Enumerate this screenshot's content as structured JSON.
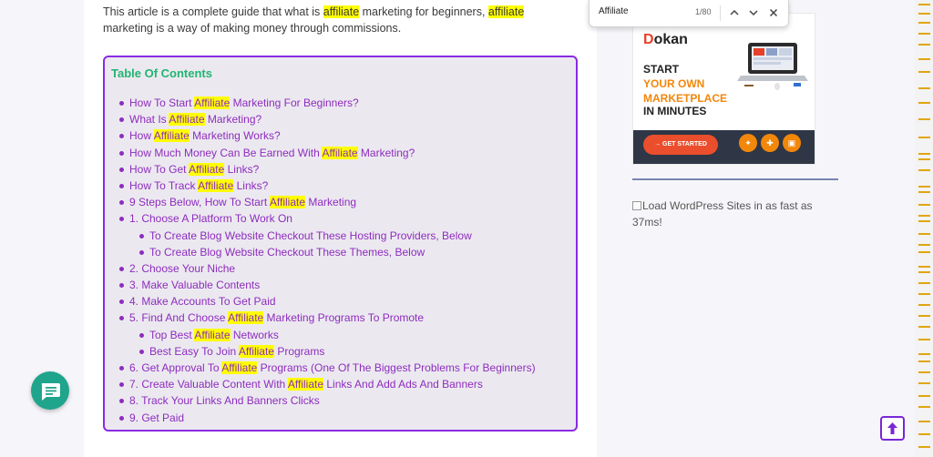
{
  "article": {
    "intro": [
      {
        "t": "This article is a complete guide that what is "
      },
      {
        "t": "affiliate",
        "hl": true
      },
      {
        "t": " marketing for beginners, "
      },
      {
        "t": "affiliate",
        "hl": true
      },
      {
        "t": " marketing is a way of making money through commissions."
      }
    ]
  },
  "toc": {
    "title": "Table Of Contents",
    "items": [
      {
        "level": 1,
        "parts": [
          {
            "t": "How To Start "
          },
          {
            "t": "Affiliate",
            "hl": true
          },
          {
            "t": " Marketing For Beginners?"
          }
        ]
      },
      {
        "level": 1,
        "parts": [
          {
            "t": "What Is "
          },
          {
            "t": "Affiliate",
            "hl": true
          },
          {
            "t": " Marketing?"
          }
        ]
      },
      {
        "level": 1,
        "parts": [
          {
            "t": "How "
          },
          {
            "t": "Affiliate",
            "hl": true
          },
          {
            "t": " Marketing Works?"
          }
        ]
      },
      {
        "level": 1,
        "parts": [
          {
            "t": "How Much Money Can Be Earned With "
          },
          {
            "t": "Affiliate",
            "hl": true
          },
          {
            "t": " Marketing?"
          }
        ]
      },
      {
        "level": 1,
        "parts": [
          {
            "t": "How To Get "
          },
          {
            "t": "Affiliate",
            "hl": true
          },
          {
            "t": " Links?"
          }
        ]
      },
      {
        "level": 1,
        "parts": [
          {
            "t": "How To Track "
          },
          {
            "t": "Affiliate",
            "hl": true
          },
          {
            "t": " Links?"
          }
        ]
      },
      {
        "level": 1,
        "parts": [
          {
            "t": "9 Steps Below, How To Start "
          },
          {
            "t": "Affiliate",
            "hl": true
          },
          {
            "t": " Marketing"
          }
        ]
      },
      {
        "level": 1,
        "parts": [
          {
            "t": "1. Choose A Platform To Work On"
          }
        ]
      },
      {
        "level": 2,
        "parts": [
          {
            "t": "To Create Blog Website Checkout These Hosting Providers, Below"
          }
        ]
      },
      {
        "level": 2,
        "parts": [
          {
            "t": "To Create Blog Website Checkout These Themes, Below"
          }
        ]
      },
      {
        "level": 1,
        "parts": [
          {
            "t": "2. Choose Your Niche"
          }
        ]
      },
      {
        "level": 1,
        "parts": [
          {
            "t": "3. Make Valuable Contents"
          }
        ]
      },
      {
        "level": 1,
        "parts": [
          {
            "t": "4. Make Accounts To Get Paid"
          }
        ]
      },
      {
        "level": 1,
        "parts": [
          {
            "t": "5. Find And Choose "
          },
          {
            "t": "Affiliate",
            "hl": true
          },
          {
            "t": " Marketing Programs To Promote"
          }
        ]
      },
      {
        "level": 2,
        "parts": [
          {
            "t": "Top Best "
          },
          {
            "t": "Affiliate",
            "hl": true
          },
          {
            "t": " Networks"
          }
        ]
      },
      {
        "level": 2,
        "parts": [
          {
            "t": "Best Easy To Join "
          },
          {
            "t": "Affiliate",
            "hl": true
          },
          {
            "t": " Programs"
          }
        ]
      },
      {
        "level": 1,
        "parts": [
          {
            "t": "6. Get Approval To "
          },
          {
            "t": "Affiliate",
            "hl": true
          },
          {
            "t": " Programs (One Of The Biggest Problems For Beginners)"
          }
        ]
      },
      {
        "level": 1,
        "parts": [
          {
            "t": "7. Create Valuable Content With "
          },
          {
            "t": "Affiliate",
            "hl": true
          },
          {
            "t": " Links And Add Ads And Banners"
          }
        ]
      },
      {
        "level": 1,
        "parts": [
          {
            "t": "8. Track Your Links And Banners Clicks"
          }
        ]
      },
      {
        "level": 1,
        "parts": [
          {
            "t": "9. Get Paid"
          }
        ]
      }
    ]
  },
  "ad": {
    "brand_d": "D",
    "brand_rest": "okan",
    "line1": "START",
    "line2": "YOUR OWN",
    "line3": "MARKETPLACE",
    "line4": "IN MINUTES",
    "cta": "→ GET STARTED"
  },
  "sidebar": {
    "broken_image_alt": "Load WordPress Sites in as fast as 37ms!"
  },
  "find_bar": {
    "query": "Affiliate",
    "count": "1/80"
  },
  "colors": {
    "toc_title": "#20b573",
    "toc_link": "#8e2cbf",
    "toc_border": "#8a2be2",
    "highlight": "#ffff00",
    "chat_button": "#1fa58c",
    "scroll_marker": "#e2a50f"
  },
  "icons": {
    "find_prev": "chevron-up-icon",
    "find_next": "chevron-down-icon",
    "find_close": "close-icon",
    "chat": "chat-bubble-icon",
    "back_to_top": "arrow-up-icon"
  }
}
